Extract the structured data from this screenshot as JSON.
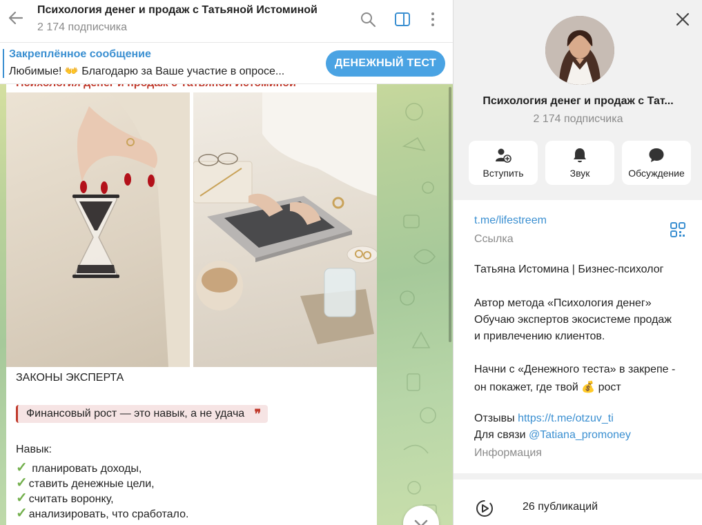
{
  "chat": {
    "title": "Психология денег и продаж с Татьяной Истоминой",
    "subscribers": "2 174 подписчика",
    "pinned": {
      "title": "Закреплённое сообщение",
      "text": "Любимые! 👐 Благодарю за Ваше участие в опросе...",
      "button": "ДЕНЕЖНЫЙ ТЕСТ"
    },
    "message": {
      "sender": "Психология денег и продаж с Татьяной Истоминой",
      "heading": "ЗАКОНЫ ЭКСПЕРТА",
      "quote": "Финансовый рост — это навык, а не удача",
      "skill_title": "Навык:",
      "skills": [
        "планировать доходы,",
        "ставить денежные цели,",
        "считать воронку,",
        "анализировать, что сработало."
      ]
    }
  },
  "info": {
    "name": "Психология денег и продаж с Тат...",
    "subscribers": "2 174 подписчика",
    "actions": [
      {
        "label": "Вступить",
        "icon": "add-user-icon"
      },
      {
        "label": "Звук",
        "icon": "bell-icon"
      },
      {
        "label": "Обсуждение",
        "icon": "chat-bubble-icon"
      }
    ],
    "link": "t.me/lifestreem",
    "link_label": "Ссылка",
    "description": {
      "line1": "Татьяна Истомина | Бизнес-психолог",
      "line2": "Автор метода «Психология денег»",
      "line3": "Обучаю экспертов экосистеме продаж",
      "line4": "и привлечению клиентов.",
      "line5": "Начни с «Денежного теста» в закрепе -",
      "line6": "он покажет, где твой 💰 рост",
      "reviews_label": "Отзывы",
      "reviews_link": "https://t.me/otzuv_ti",
      "contact_label": "Для связи",
      "contact_link": "@Tatiana_promoney"
    },
    "info_label": "Информация",
    "publications": "26 публикаций"
  },
  "colors": {
    "accent": "#3a8fd1",
    "button": "#4aa3e3",
    "quote_red": "#c0392b",
    "check_green": "#73b04d"
  }
}
